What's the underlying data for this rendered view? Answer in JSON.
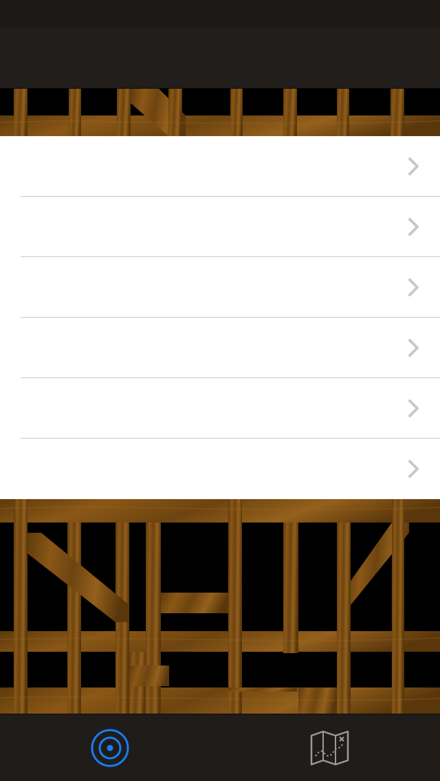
{
  "status_bar": {},
  "nav_bar": {
    "title": ""
  },
  "table": {
    "rows": [
      {
        "label": ""
      },
      {
        "label": ""
      },
      {
        "label": ""
      },
      {
        "label": ""
      },
      {
        "label": ""
      },
      {
        "label": ""
      }
    ]
  },
  "tab_bar": {
    "tabs": [
      {
        "icon": "target-icon",
        "label": "",
        "selected": true
      },
      {
        "icon": "treasure-map-icon",
        "label": "",
        "selected": false
      }
    ]
  },
  "colors": {
    "accent": "#1a7cf5",
    "wood": "#7a4c12",
    "chevron": "#c7c7cc",
    "bar_background": "#1f1c1a"
  }
}
